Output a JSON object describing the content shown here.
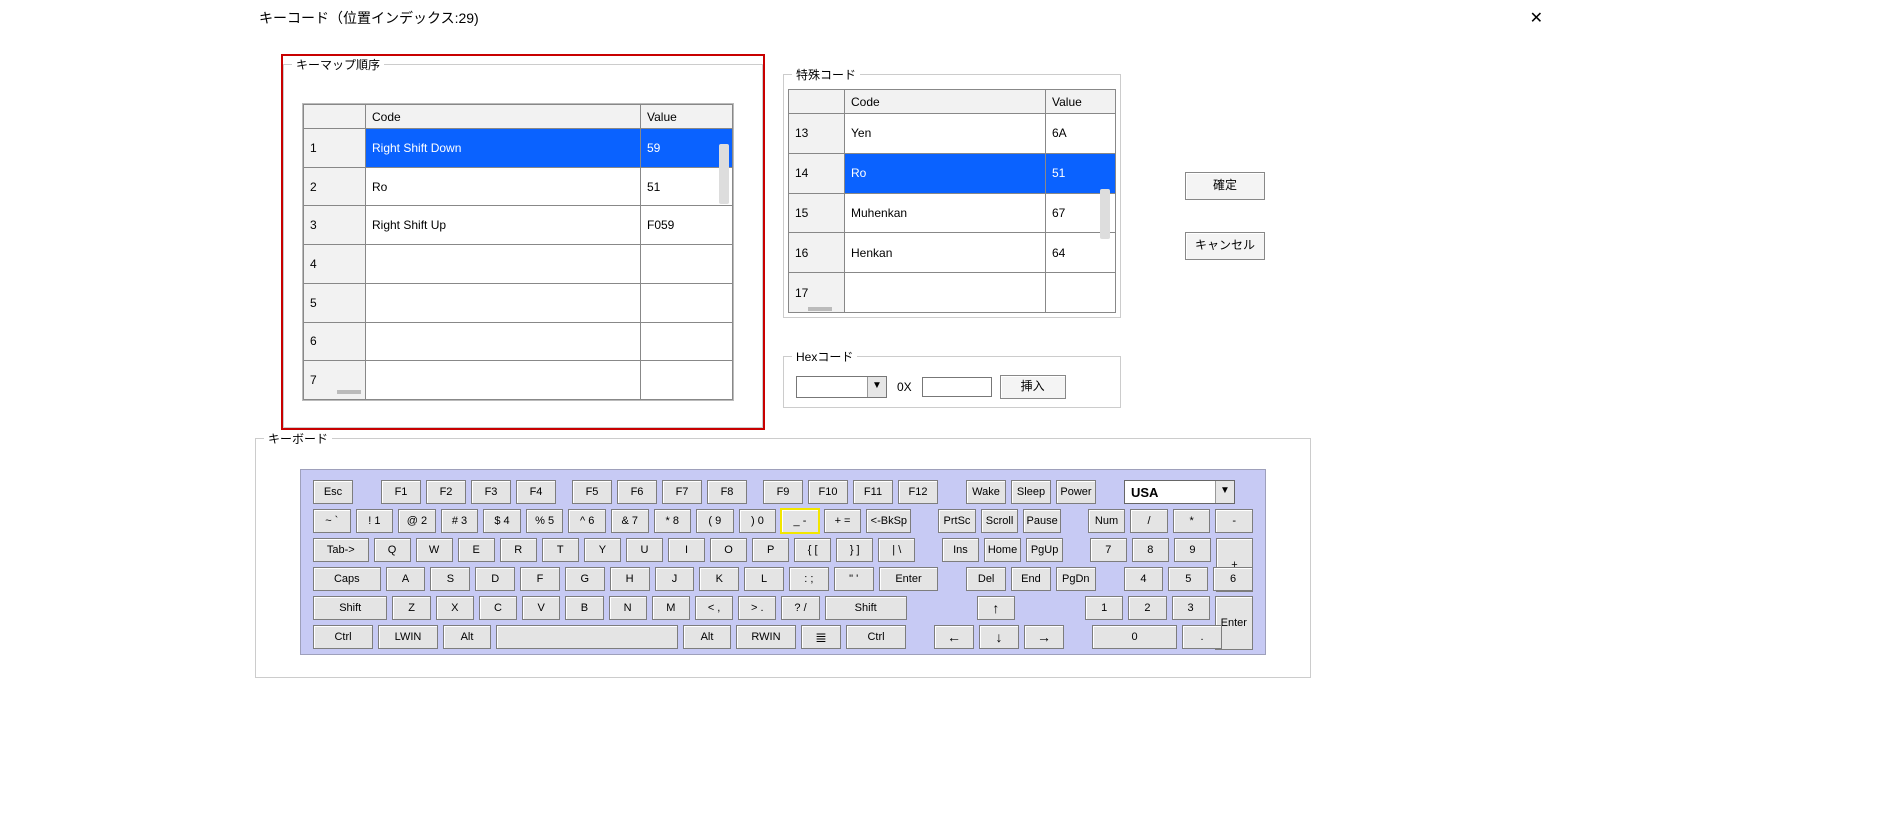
{
  "title": "キーコード（位置インデックス:29)",
  "groups": {
    "keymap_order": "キーマップ順序",
    "special_code": "特殊コード",
    "hex_code": "Hexコード",
    "keyboard": "キーボード"
  },
  "columns": {
    "code": "Code",
    "value": "Value"
  },
  "keymap": {
    "rows": [
      {
        "idx": "1",
        "code": "Right Shift Down",
        "value": "59",
        "selected": true
      },
      {
        "idx": "2",
        "code": "Ro",
        "value": "51"
      },
      {
        "idx": "3",
        "code": "Right Shift Up",
        "value": "F059"
      },
      {
        "idx": "4",
        "code": "",
        "value": ""
      },
      {
        "idx": "5",
        "code": "",
        "value": ""
      },
      {
        "idx": "6",
        "code": "",
        "value": ""
      },
      {
        "idx": "7",
        "code": "",
        "value": ""
      }
    ]
  },
  "special": {
    "rows": [
      {
        "idx": "13",
        "code": "Yen",
        "value": "6A"
      },
      {
        "idx": "14",
        "code": "Ro",
        "value": "51",
        "selected": true
      },
      {
        "idx": "15",
        "code": "Muhenkan",
        "value": "67"
      },
      {
        "idx": "16",
        "code": "Henkan",
        "value": "64"
      },
      {
        "idx": "17",
        "code": "",
        "value": ""
      }
    ]
  },
  "hex": {
    "prefix_label": "0X",
    "insert_label": "挿入",
    "combo_value": "",
    "hex_value": ""
  },
  "buttons": {
    "ok": "確定",
    "cancel": "キャンセル"
  },
  "keyboard": {
    "layout_selected": "USA",
    "row0": [
      "Esc",
      "F1",
      "F2",
      "F3",
      "F4",
      "F5",
      "F6",
      "F7",
      "F8",
      "F9",
      "F10",
      "F11",
      "F12",
      "Wake",
      "Sleep",
      "Power"
    ],
    "row1": [
      "~  `",
      "!  1",
      "@  2",
      "#  3",
      "$  4",
      "%  5",
      "^  6",
      "&  7",
      "*  8",
      "(  9",
      ")  0",
      "_  -",
      "+  =",
      "<-BkSp",
      "PrtSc",
      "Scroll",
      "Pause",
      "Num",
      "/",
      "*",
      "-"
    ],
    "row1_selected_index": 11,
    "row2": [
      "Tab->",
      "Q",
      "W",
      "E",
      "R",
      "T",
      "Y",
      "U",
      "I",
      "O",
      "P",
      "{  [",
      "}  ]",
      "|  \\",
      "Ins",
      "Home",
      "PgUp",
      "7",
      "8",
      "9"
    ],
    "row3": [
      "Caps",
      "A",
      "S",
      "D",
      "F",
      "G",
      "H",
      "J",
      "K",
      "L",
      ":  ;",
      "\"  '",
      "Enter",
      "Del",
      "End",
      "PgDn",
      "4",
      "5",
      "6"
    ],
    "row4": [
      "Shift",
      "Z",
      "X",
      "C",
      "V",
      "B",
      "N",
      "M",
      "<  ,",
      ">  .",
      "?  /",
      "Shift",
      "↑",
      "1",
      "2",
      "3"
    ],
    "row5": [
      "Ctrl",
      "LWIN",
      "Alt",
      "",
      "Alt",
      "RWIN",
      "≣",
      "Ctrl",
      "←",
      "↓",
      "→",
      "0",
      "."
    ],
    "numpad_plus": "+",
    "numpad_enter": "Enter"
  }
}
